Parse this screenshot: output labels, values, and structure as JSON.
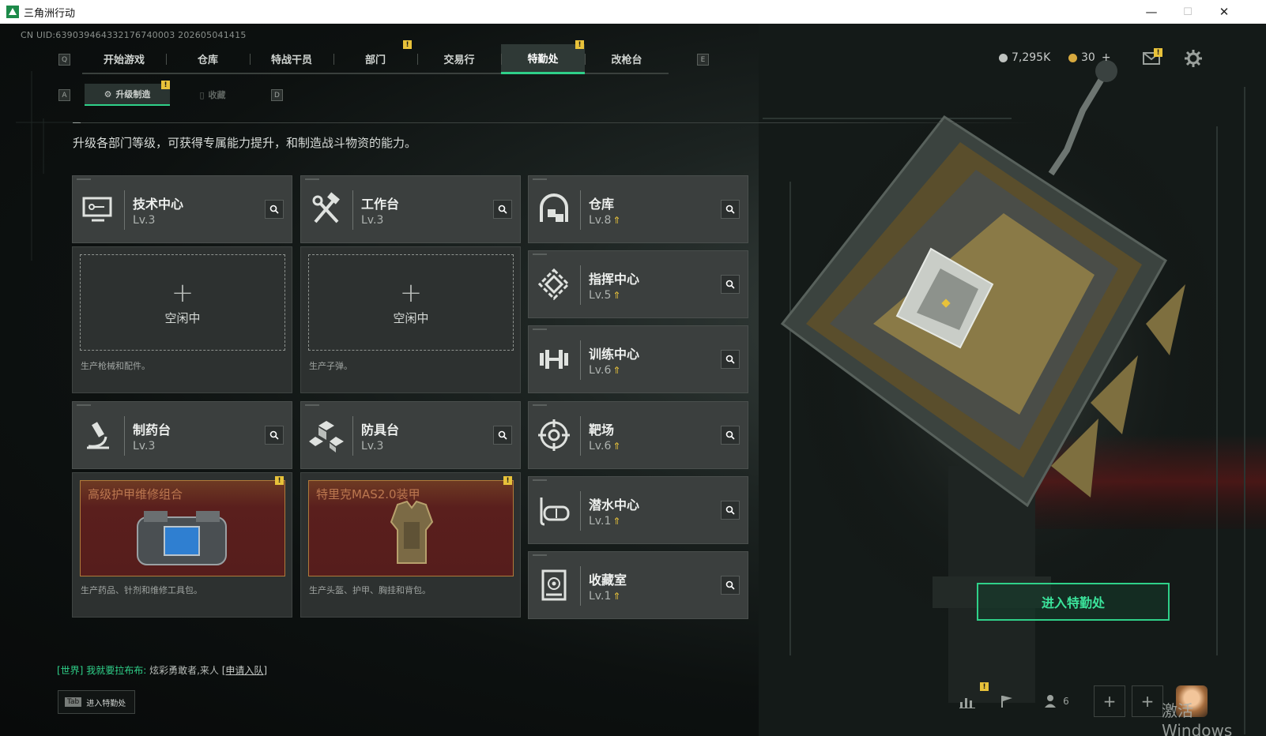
{
  "window": {
    "title": "三角洲行动",
    "controls": {
      "minimize": "—",
      "maximize": "☐",
      "close": "✕"
    }
  },
  "uid": "CN UID:639039464332176740003 202605041415",
  "key_hints": {
    "left_tab": "Q",
    "right_tab": "E",
    "left_sub": "A",
    "right_sub": "D"
  },
  "nav": {
    "tabs": [
      {
        "label": "开始游戏"
      },
      {
        "label": "仓库"
      },
      {
        "label": "特战干员"
      },
      {
        "label": "部门",
        "badge": "!"
      },
      {
        "label": "交易行"
      },
      {
        "label": "特勤处",
        "badge": "!",
        "active": true
      },
      {
        "label": "改枪台"
      }
    ]
  },
  "currency": {
    "coins": "7,295K",
    "tickets": "30",
    "plus": "+"
  },
  "subnav": {
    "tabs": [
      {
        "label": "升级制造",
        "active": true,
        "badge": "!"
      },
      {
        "label": "收藏"
      }
    ]
  },
  "description": "升级各部门等级，可获得专属能力提升，和制造战斗物资的能力。",
  "facilities": {
    "tech_center": {
      "name": "技术中心",
      "level": "Lv.3",
      "slot_status": "空闲中",
      "hint": "生产枪械和配件。"
    },
    "workbench": {
      "name": "工作台",
      "level": "Lv.3",
      "slot_status": "空闲中",
      "hint": "生产子弹。"
    },
    "pharmacy": {
      "name": "制药台",
      "level": "Lv.3",
      "product": "高级护甲维修组合",
      "hint": "生产药品、针剂和维修工具包。"
    },
    "armor_bench": {
      "name": "防具台",
      "level": "Lv.3",
      "product": "特里克MAS2.0装甲",
      "hint": "生产头盔、护甲、胸挂和背包。"
    },
    "side": [
      {
        "name": "仓库",
        "level": "Lv.8",
        "upgradable": true,
        "icon": "storage-icon"
      },
      {
        "name": "指挥中心",
        "level": "Lv.5",
        "upgradable": true,
        "icon": "command-center-icon"
      },
      {
        "name": "训练中心",
        "level": "Lv.6",
        "upgradable": true,
        "icon": "dumbbell-icon"
      },
      {
        "name": "靶场",
        "level": "Lv.6",
        "upgradable": true,
        "icon": "target-icon"
      },
      {
        "name": "潜水中心",
        "level": "Lv.1",
        "upgradable": true,
        "icon": "diving-mask-icon"
      },
      {
        "name": "收藏室",
        "level": "Lv.1",
        "upgradable": true,
        "icon": "collection-room-icon"
      }
    ]
  },
  "enter_button": "进入特勤处",
  "chat": {
    "channel": "[世界]",
    "sender": "我就要拉布布:",
    "message": "炫彩勇敢者,来人",
    "action": "[申请入队]"
  },
  "tab_hint": {
    "key": "Tab",
    "label": "进入特勤处"
  },
  "bottom": {
    "friends_count": "6",
    "badge": "!",
    "plus": "+"
  },
  "watermark": "激活 Windows",
  "colors": {
    "accent": "#2fd089",
    "badge": "#e8c23a",
    "card": "#3b3f3e",
    "product_bg": "#5a1f1d"
  }
}
